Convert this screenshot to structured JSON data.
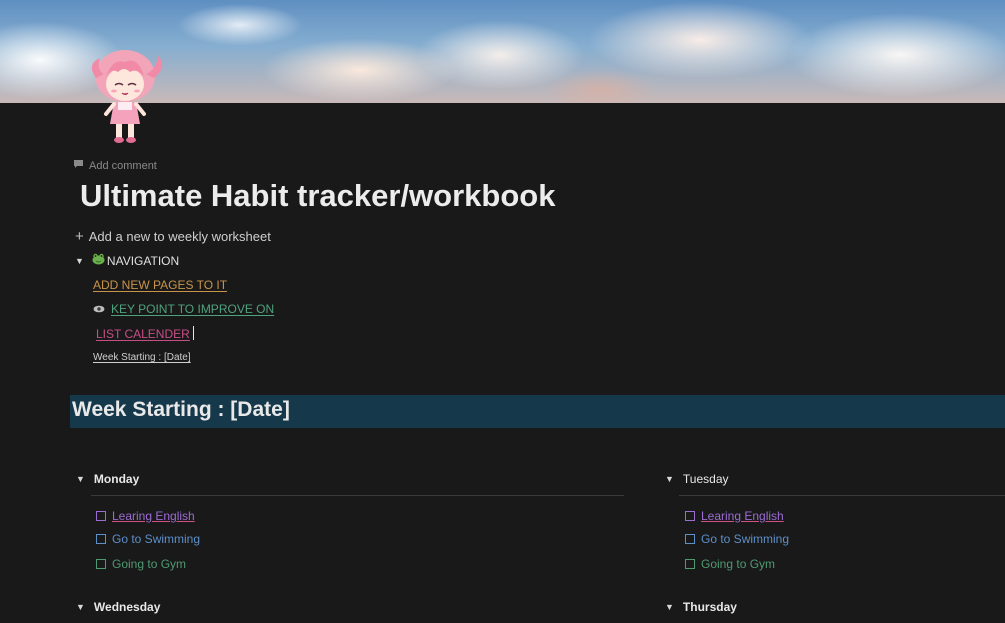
{
  "cover": {
    "icon": "anime-girl-avatar"
  },
  "add_comment": "Add comment",
  "page_title": "Ultimate Habit tracker/workbook",
  "add_worksheet": "Add a new to weekly worksheet",
  "navigation": {
    "toggle_label": "NAVIGATION",
    "toggle_icon": "frog-icon",
    "links": {
      "add_pages": "ADD NEW PAGES TO IT",
      "key_point": "KEY POINT TO IMPROVE ON",
      "list_calendar": "LIST CALENDER",
      "week_starting": "Week Starting : [Date]"
    }
  },
  "week_heading": "Week Starting : [Date]",
  "days": {
    "monday": {
      "label": "Monday",
      "tasks": [
        "Learing English",
        "Go to Swimming",
        "Going to Gym"
      ]
    },
    "tuesday": {
      "label": "Tuesday",
      "tasks": [
        "Learing English",
        "Go to Swimming",
        "Going to Gym"
      ]
    },
    "wednesday": {
      "label": "Wednesday"
    },
    "thursday": {
      "label": "Thursday"
    }
  },
  "colors": {
    "background": "#191919",
    "heading_bar": "#15384b",
    "link_orange": "#c99449",
    "link_green": "#4fa27e",
    "link_pink": "#c64e86",
    "task_purple": "#9b6cd2",
    "task_blue": "#5d8fc8",
    "task_green": "#4f9a72"
  }
}
